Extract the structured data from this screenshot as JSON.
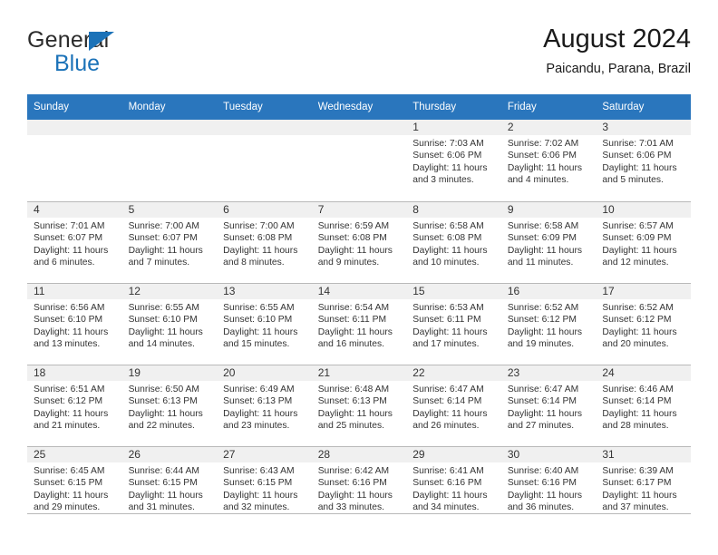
{
  "brand": {
    "name_top": "General",
    "name_bottom": "Blue",
    "triangle_color": "#1b72b8"
  },
  "header": {
    "title": "August 2024",
    "subtitle": "Paicandu, Parana, Brazil"
  },
  "theme": {
    "header_blue": "#2a76bd",
    "daynum_band": "#f0f0f0",
    "grid_line": "#b9b9b9",
    "text": "#333333"
  },
  "weekday_headers": [
    "Sunday",
    "Monday",
    "Tuesday",
    "Wednesday",
    "Thursday",
    "Friday",
    "Saturday"
  ],
  "labels": {
    "sunrise_prefix": "Sunrise:",
    "sunset_prefix": "Sunset:",
    "daylight_prefix": "Daylight:"
  },
  "weeks": [
    [
      {
        "day": "",
        "sunrise": "",
        "sunset": "",
        "daylight_line1": "",
        "daylight_line2": ""
      },
      {
        "day": "",
        "sunrise": "",
        "sunset": "",
        "daylight_line1": "",
        "daylight_line2": ""
      },
      {
        "day": "",
        "sunrise": "",
        "sunset": "",
        "daylight_line1": "",
        "daylight_line2": ""
      },
      {
        "day": "",
        "sunrise": "",
        "sunset": "",
        "daylight_line1": "",
        "daylight_line2": ""
      },
      {
        "day": "1",
        "sunrise": "Sunrise: 7:03 AM",
        "sunset": "Sunset: 6:06 PM",
        "daylight_line1": "Daylight: 11 hours",
        "daylight_line2": "and 3 minutes."
      },
      {
        "day": "2",
        "sunrise": "Sunrise: 7:02 AM",
        "sunset": "Sunset: 6:06 PM",
        "daylight_line1": "Daylight: 11 hours",
        "daylight_line2": "and 4 minutes."
      },
      {
        "day": "3",
        "sunrise": "Sunrise: 7:01 AM",
        "sunset": "Sunset: 6:06 PM",
        "daylight_line1": "Daylight: 11 hours",
        "daylight_line2": "and 5 minutes."
      }
    ],
    [
      {
        "day": "4",
        "sunrise": "Sunrise: 7:01 AM",
        "sunset": "Sunset: 6:07 PM",
        "daylight_line1": "Daylight: 11 hours",
        "daylight_line2": "and 6 minutes."
      },
      {
        "day": "5",
        "sunrise": "Sunrise: 7:00 AM",
        "sunset": "Sunset: 6:07 PM",
        "daylight_line1": "Daylight: 11 hours",
        "daylight_line2": "and 7 minutes."
      },
      {
        "day": "6",
        "sunrise": "Sunrise: 7:00 AM",
        "sunset": "Sunset: 6:08 PM",
        "daylight_line1": "Daylight: 11 hours",
        "daylight_line2": "and 8 minutes."
      },
      {
        "day": "7",
        "sunrise": "Sunrise: 6:59 AM",
        "sunset": "Sunset: 6:08 PM",
        "daylight_line1": "Daylight: 11 hours",
        "daylight_line2": "and 9 minutes."
      },
      {
        "day": "8",
        "sunrise": "Sunrise: 6:58 AM",
        "sunset": "Sunset: 6:08 PM",
        "daylight_line1": "Daylight: 11 hours",
        "daylight_line2": "and 10 minutes."
      },
      {
        "day": "9",
        "sunrise": "Sunrise: 6:58 AM",
        "sunset": "Sunset: 6:09 PM",
        "daylight_line1": "Daylight: 11 hours",
        "daylight_line2": "and 11 minutes."
      },
      {
        "day": "10",
        "sunrise": "Sunrise: 6:57 AM",
        "sunset": "Sunset: 6:09 PM",
        "daylight_line1": "Daylight: 11 hours",
        "daylight_line2": "and 12 minutes."
      }
    ],
    [
      {
        "day": "11",
        "sunrise": "Sunrise: 6:56 AM",
        "sunset": "Sunset: 6:10 PM",
        "daylight_line1": "Daylight: 11 hours",
        "daylight_line2": "and 13 minutes."
      },
      {
        "day": "12",
        "sunrise": "Sunrise: 6:55 AM",
        "sunset": "Sunset: 6:10 PM",
        "daylight_line1": "Daylight: 11 hours",
        "daylight_line2": "and 14 minutes."
      },
      {
        "day": "13",
        "sunrise": "Sunrise: 6:55 AM",
        "sunset": "Sunset: 6:10 PM",
        "daylight_line1": "Daylight: 11 hours",
        "daylight_line2": "and 15 minutes."
      },
      {
        "day": "14",
        "sunrise": "Sunrise: 6:54 AM",
        "sunset": "Sunset: 6:11 PM",
        "daylight_line1": "Daylight: 11 hours",
        "daylight_line2": "and 16 minutes."
      },
      {
        "day": "15",
        "sunrise": "Sunrise: 6:53 AM",
        "sunset": "Sunset: 6:11 PM",
        "daylight_line1": "Daylight: 11 hours",
        "daylight_line2": "and 17 minutes."
      },
      {
        "day": "16",
        "sunrise": "Sunrise: 6:52 AM",
        "sunset": "Sunset: 6:12 PM",
        "daylight_line1": "Daylight: 11 hours",
        "daylight_line2": "and 19 minutes."
      },
      {
        "day": "17",
        "sunrise": "Sunrise: 6:52 AM",
        "sunset": "Sunset: 6:12 PM",
        "daylight_line1": "Daylight: 11 hours",
        "daylight_line2": "and 20 minutes."
      }
    ],
    [
      {
        "day": "18",
        "sunrise": "Sunrise: 6:51 AM",
        "sunset": "Sunset: 6:12 PM",
        "daylight_line1": "Daylight: 11 hours",
        "daylight_line2": "and 21 minutes."
      },
      {
        "day": "19",
        "sunrise": "Sunrise: 6:50 AM",
        "sunset": "Sunset: 6:13 PM",
        "daylight_line1": "Daylight: 11 hours",
        "daylight_line2": "and 22 minutes."
      },
      {
        "day": "20",
        "sunrise": "Sunrise: 6:49 AM",
        "sunset": "Sunset: 6:13 PM",
        "daylight_line1": "Daylight: 11 hours",
        "daylight_line2": "and 23 minutes."
      },
      {
        "day": "21",
        "sunrise": "Sunrise: 6:48 AM",
        "sunset": "Sunset: 6:13 PM",
        "daylight_line1": "Daylight: 11 hours",
        "daylight_line2": "and 25 minutes."
      },
      {
        "day": "22",
        "sunrise": "Sunrise: 6:47 AM",
        "sunset": "Sunset: 6:14 PM",
        "daylight_line1": "Daylight: 11 hours",
        "daylight_line2": "and 26 minutes."
      },
      {
        "day": "23",
        "sunrise": "Sunrise: 6:47 AM",
        "sunset": "Sunset: 6:14 PM",
        "daylight_line1": "Daylight: 11 hours",
        "daylight_line2": "and 27 minutes."
      },
      {
        "day": "24",
        "sunrise": "Sunrise: 6:46 AM",
        "sunset": "Sunset: 6:14 PM",
        "daylight_line1": "Daylight: 11 hours",
        "daylight_line2": "and 28 minutes."
      }
    ],
    [
      {
        "day": "25",
        "sunrise": "Sunrise: 6:45 AM",
        "sunset": "Sunset: 6:15 PM",
        "daylight_line1": "Daylight: 11 hours",
        "daylight_line2": "and 29 minutes."
      },
      {
        "day": "26",
        "sunrise": "Sunrise: 6:44 AM",
        "sunset": "Sunset: 6:15 PM",
        "daylight_line1": "Daylight: 11 hours",
        "daylight_line2": "and 31 minutes."
      },
      {
        "day": "27",
        "sunrise": "Sunrise: 6:43 AM",
        "sunset": "Sunset: 6:15 PM",
        "daylight_line1": "Daylight: 11 hours",
        "daylight_line2": "and 32 minutes."
      },
      {
        "day": "28",
        "sunrise": "Sunrise: 6:42 AM",
        "sunset": "Sunset: 6:16 PM",
        "daylight_line1": "Daylight: 11 hours",
        "daylight_line2": "and 33 minutes."
      },
      {
        "day": "29",
        "sunrise": "Sunrise: 6:41 AM",
        "sunset": "Sunset: 6:16 PM",
        "daylight_line1": "Daylight: 11 hours",
        "daylight_line2": "and 34 minutes."
      },
      {
        "day": "30",
        "sunrise": "Sunrise: 6:40 AM",
        "sunset": "Sunset: 6:16 PM",
        "daylight_line1": "Daylight: 11 hours",
        "daylight_line2": "and 36 minutes."
      },
      {
        "day": "31",
        "sunrise": "Sunrise: 6:39 AM",
        "sunset": "Sunset: 6:17 PM",
        "daylight_line1": "Daylight: 11 hours",
        "daylight_line2": "and 37 minutes."
      }
    ]
  ]
}
